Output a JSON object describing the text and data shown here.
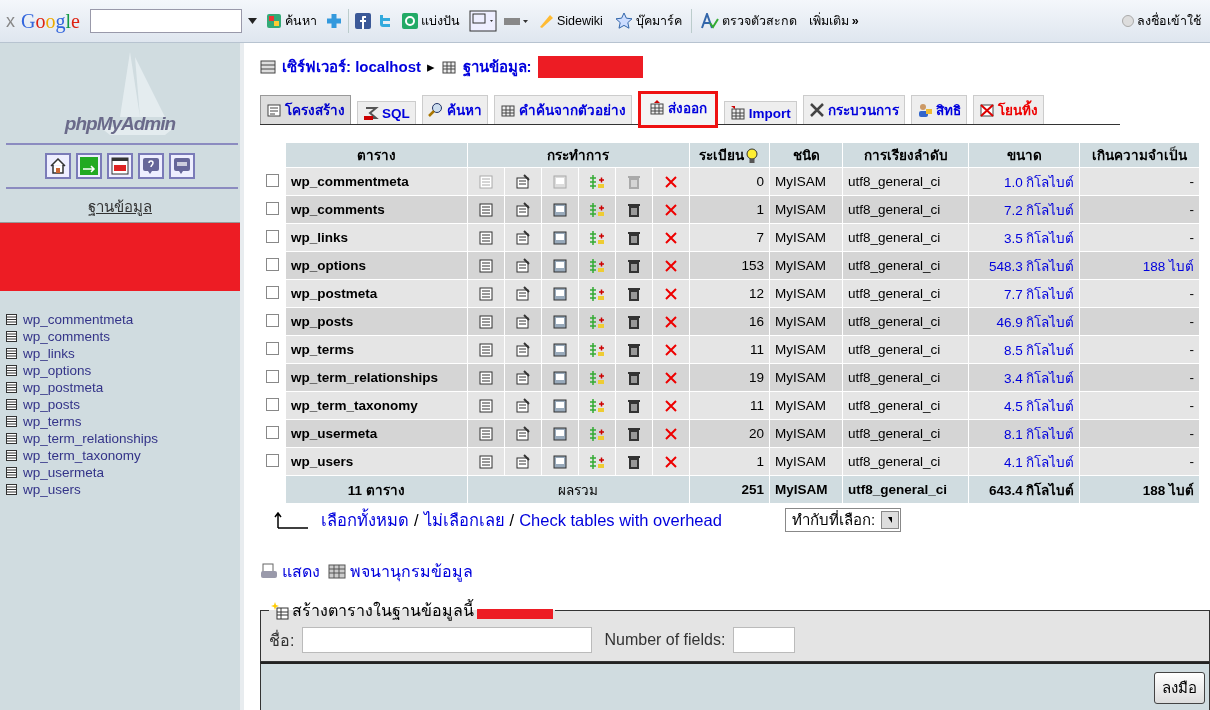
{
  "browser_toolbar": {
    "close": "x",
    "logo": "Google",
    "search_button": "ค้นหา",
    "share": "แบ่งปัน",
    "sidewiki": "Sidewiki",
    "bookmarks": "บุ๊คมาร์ค",
    "spellcheck": "ตรวจตัวสะกด",
    "more": "เพิ่มเติม",
    "more_arrows": "»",
    "sign_in": "ลงชื่อเข้าใช้"
  },
  "sidebar": {
    "logo": "phpMyAdmin",
    "database_label": "ฐานข้อมูล",
    "tables": [
      "wp_commentmeta",
      "wp_comments",
      "wp_links",
      "wp_options",
      "wp_postmeta",
      "wp_posts",
      "wp_terms",
      "wp_term_relationships",
      "wp_term_taxonomy",
      "wp_usermeta",
      "wp_users"
    ]
  },
  "breadcrumb": {
    "server": "เซิร์ฟเวอร์: localhost",
    "separator": "▸",
    "database": "ฐานข้อมูล:"
  },
  "tabs": [
    {
      "label": "โครงสร้าง",
      "selected": true,
      "highlighted": false,
      "kind": "structure"
    },
    {
      "label": "SQL",
      "selected": false,
      "highlighted": false,
      "kind": "sql"
    },
    {
      "label": "ค้นหา",
      "selected": false,
      "highlighted": false,
      "kind": "search"
    },
    {
      "label": "คำค้นจากตัวอย่าง",
      "selected": false,
      "highlighted": false,
      "kind": "query"
    },
    {
      "label": "ส่งออก",
      "selected": false,
      "highlighted": true,
      "kind": "export"
    },
    {
      "label": "Import",
      "selected": false,
      "highlighted": false,
      "kind": "import"
    },
    {
      "label": "กระบวนการ",
      "selected": false,
      "highlighted": false,
      "kind": "operations"
    },
    {
      "label": "สิทธิ",
      "selected": false,
      "highlighted": false,
      "kind": "privileges"
    },
    {
      "label": "โยนทิ้ง",
      "selected": false,
      "highlighted": false,
      "kind": "drop"
    }
  ],
  "table": {
    "columns": [
      "ตาราง",
      "กระทำการ",
      "ระเบียน",
      "ชนิด",
      "การเรียงลำดับ",
      "ขนาด",
      "เกินความจำเป็น"
    ],
    "rows": [
      {
        "name": "wp_commentmeta",
        "checked": false,
        "empty": true,
        "records": "0",
        "type": "MyISAM",
        "collation": "utf8_general_ci",
        "size": "1.0 กิโลไบต์",
        "overhead": "-"
      },
      {
        "name": "wp_comments",
        "checked": false,
        "empty": false,
        "records": "1",
        "type": "MyISAM",
        "collation": "utf8_general_ci",
        "size": "7.2 กิโลไบต์",
        "overhead": "-"
      },
      {
        "name": "wp_links",
        "checked": false,
        "empty": false,
        "records": "7",
        "type": "MyISAM",
        "collation": "utf8_general_ci",
        "size": "3.5 กิโลไบต์",
        "overhead": "-"
      },
      {
        "name": "wp_options",
        "checked": false,
        "empty": false,
        "records": "153",
        "type": "MyISAM",
        "collation": "utf8_general_ci",
        "size": "548.3 กิโลไบต์",
        "overhead": "188 ไบต์"
      },
      {
        "name": "wp_postmeta",
        "checked": false,
        "empty": false,
        "records": "12",
        "type": "MyISAM",
        "collation": "utf8_general_ci",
        "size": "7.7 กิโลไบต์",
        "overhead": "-"
      },
      {
        "name": "wp_posts",
        "checked": false,
        "empty": false,
        "records": "16",
        "type": "MyISAM",
        "collation": "utf8_general_ci",
        "size": "46.9 กิโลไบต์",
        "overhead": "-"
      },
      {
        "name": "wp_terms",
        "checked": false,
        "empty": false,
        "records": "11",
        "type": "MyISAM",
        "collation": "utf8_general_ci",
        "size": "8.5 กิโลไบต์",
        "overhead": "-"
      },
      {
        "name": "wp_term_relationships",
        "checked": false,
        "empty": false,
        "records": "19",
        "type": "MyISAM",
        "collation": "utf8_general_ci",
        "size": "3.4 กิโลไบต์",
        "overhead": "-"
      },
      {
        "name": "wp_term_taxonomy",
        "checked": false,
        "empty": false,
        "records": "11",
        "type": "MyISAM",
        "collation": "utf8_general_ci",
        "size": "4.5 กิโลไบต์",
        "overhead": "-"
      },
      {
        "name": "wp_usermeta",
        "checked": false,
        "empty": false,
        "records": "20",
        "type": "MyISAM",
        "collation": "utf8_general_ci",
        "size": "8.1 กิโลไบต์",
        "overhead": "-"
      },
      {
        "name": "wp_users",
        "checked": false,
        "empty": false,
        "records": "1",
        "type": "MyISAM",
        "collation": "utf8_general_ci",
        "size": "4.1 กิโลไบต์",
        "overhead": "-"
      }
    ],
    "footer": {
      "count": "11 ตาราง",
      "label": "ผลรวม",
      "records": "251",
      "type": "MyISAM",
      "collation": "utf8_general_ci",
      "size": "643.4 กิโลไบต์",
      "overhead": "188 ไบต์"
    }
  },
  "selection": {
    "check_all": "เลือกทั้งหมด",
    "sep1": "/",
    "uncheck_all": "ไม่เลือกเลย",
    "sep2": "/",
    "check_overhead": "Check tables with overhead",
    "with_selected": "ทำกับที่เลือก:"
  },
  "links": {
    "print": "แสดง",
    "dictionary": "พจนานุกรมข้อมูล"
  },
  "create_table": {
    "legend": "สร้างตารางในฐานข้อมูลนี้",
    "name_label": "ชื่อ:",
    "fields_label": "Number of fields:",
    "go": "ลงมือ"
  }
}
